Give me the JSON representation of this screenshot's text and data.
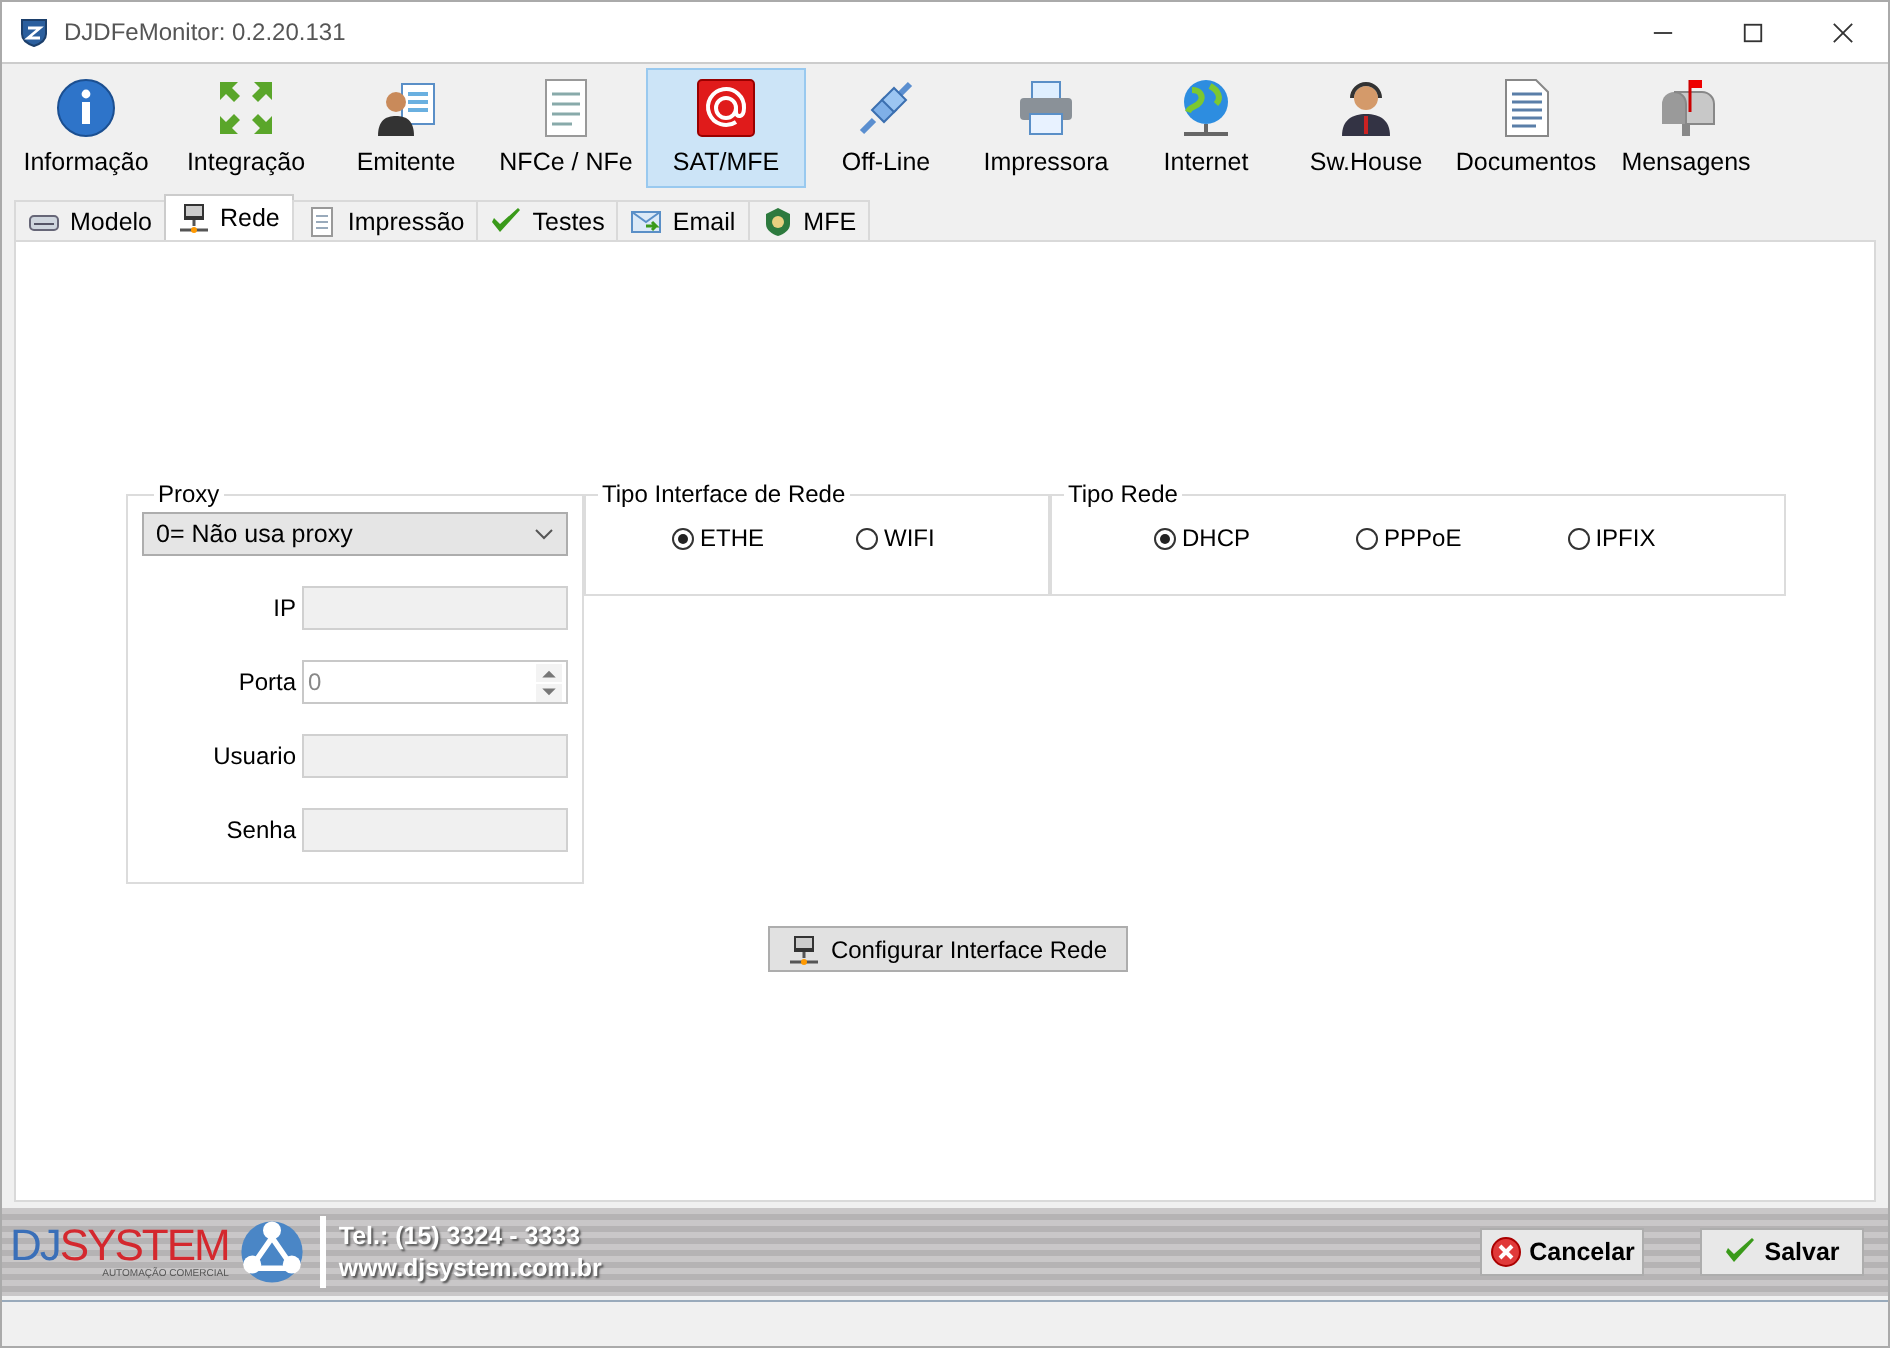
{
  "window": {
    "title": "DJDFeMonitor: 0.2.20.131"
  },
  "toolbar": [
    {
      "label": "Informação",
      "selected": false
    },
    {
      "label": "Integração",
      "selected": false
    },
    {
      "label": "Emitente",
      "selected": false
    },
    {
      "label": "NFCe / NFe",
      "selected": false
    },
    {
      "label": "SAT/MFE",
      "selected": true
    },
    {
      "label": "Off-Line",
      "selected": false
    },
    {
      "label": "Impressora",
      "selected": false
    },
    {
      "label": "Internet",
      "selected": false
    },
    {
      "label": "Sw.House",
      "selected": false
    },
    {
      "label": "Documentos",
      "selected": false
    },
    {
      "label": "Mensagens",
      "selected": false
    }
  ],
  "tabs": [
    {
      "label": "Modelo",
      "selected": false
    },
    {
      "label": "Rede",
      "selected": true
    },
    {
      "label": "Impressão",
      "selected": false
    },
    {
      "label": "Testes",
      "selected": false
    },
    {
      "label": "Email",
      "selected": false
    },
    {
      "label": "MFE",
      "selected": false
    }
  ],
  "proxy": {
    "title": "Proxy",
    "dropdown": "0= Não usa proxy",
    "fields": [
      {
        "label": "IP",
        "kind": "text"
      },
      {
        "label": "Porta",
        "kind": "spin",
        "value": "0"
      },
      {
        "label": "Usuario",
        "kind": "text"
      },
      {
        "label": "Senha",
        "kind": "text"
      }
    ]
  },
  "interface_group": {
    "title": "Tipo Interface de Rede",
    "options": [
      {
        "label": "ETHE",
        "selected": true
      },
      {
        "label": "WIFI",
        "selected": false
      }
    ]
  },
  "network_group": {
    "title": "Tipo Rede",
    "options": [
      {
        "label": "DHCP",
        "selected": true
      },
      {
        "label": "PPPoE",
        "selected": false
      },
      {
        "label": "IPFIX",
        "selected": false
      }
    ]
  },
  "configure_button": "Configurar Interface Rede",
  "footer": {
    "logo_prefix": "DJ",
    "logo_name": "SYSTEM",
    "logo_tagline": "AUTOMAÇÃO COMERCIAL",
    "phone": "Tel.: (15) 3324 - 3333",
    "website": "www.djsystem.com.br",
    "cancel": "Cancelar",
    "save": "Salvar"
  }
}
